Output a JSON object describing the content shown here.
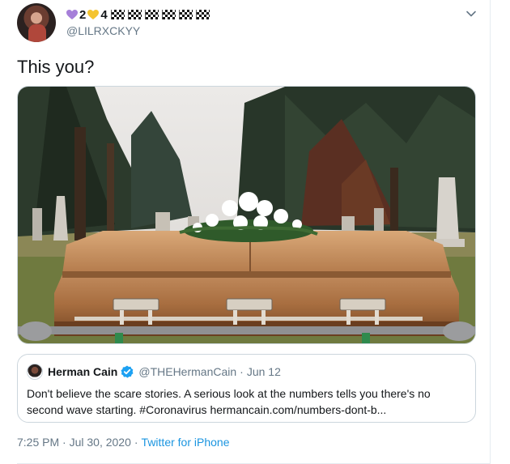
{
  "tweet": {
    "display_name_chars": [
      "2",
      "4"
    ],
    "handle": "@LILRXCKYY",
    "text": "This you?",
    "timestamp": "7:25 PM · Jul 30, 2020",
    "separator": "·",
    "source": "Twitter for iPhone"
  },
  "icons": {
    "heart_purple": "#a67fd9",
    "heart_yellow": "#f4c430",
    "flag_count": 6
  },
  "quote": {
    "name": "Herman Cain",
    "handle": "@THEHermanCain",
    "dot": "·",
    "date": "Jun 12",
    "text": "Don't believe the scare stories. A serious look at the numbers tells you there's no second wave starting. #Coronavirus hermancain.com/numbers-dont-b..."
  },
  "colors": {
    "link": "#1b95e0",
    "verified": "#1da1f2",
    "muted": "#657786"
  }
}
